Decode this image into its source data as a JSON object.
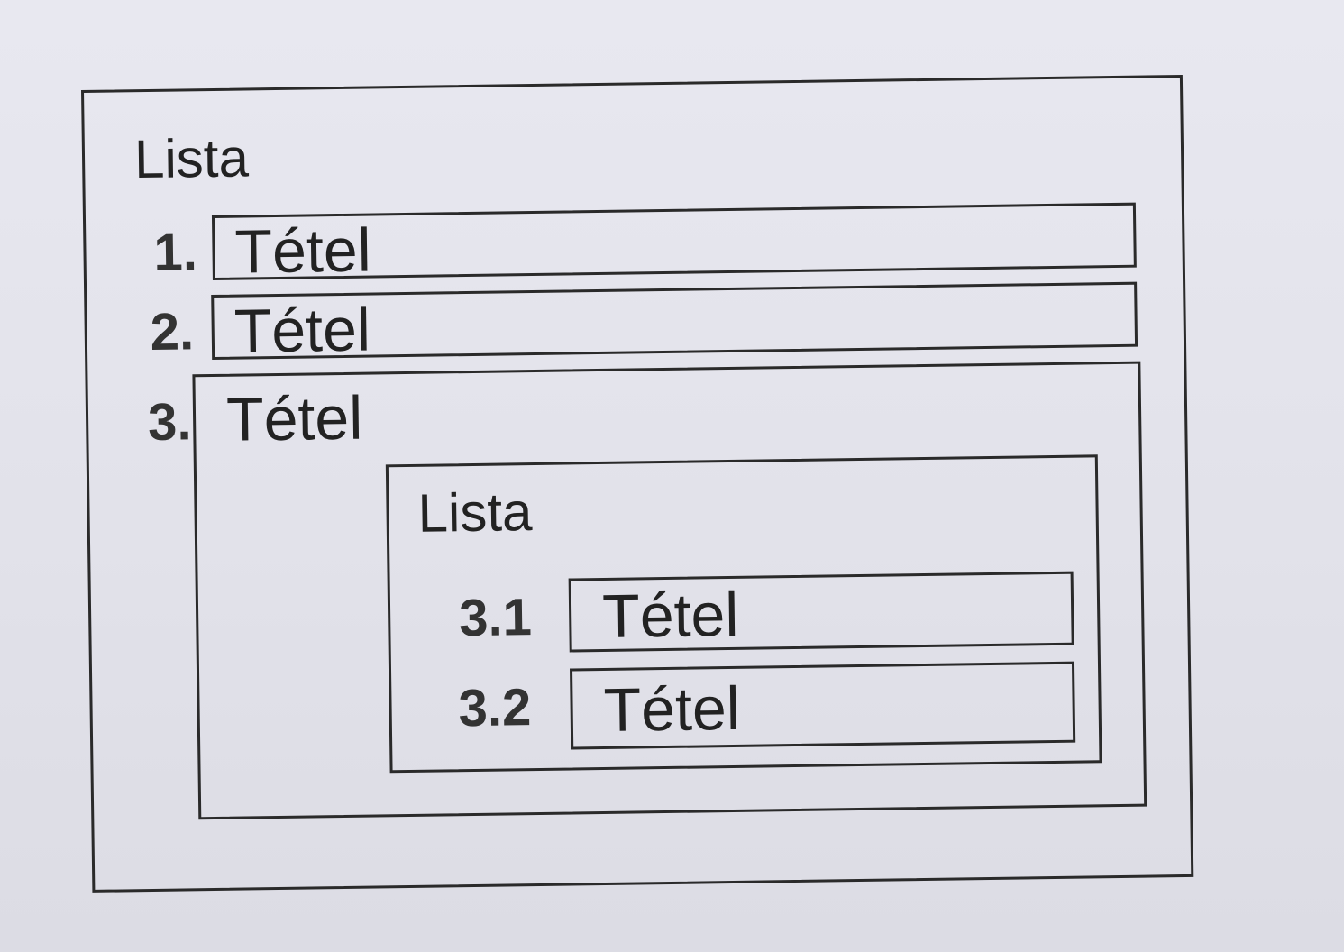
{
  "outer_list": {
    "title": "Lista",
    "items": [
      {
        "number": "1.",
        "text": "Tétel"
      },
      {
        "number": "2.",
        "text": "Tétel"
      },
      {
        "number": "3.",
        "text": "Tétel"
      }
    ]
  },
  "inner_list": {
    "title": "Lista",
    "items": [
      {
        "number": "3.1",
        "text": "Tétel"
      },
      {
        "number": "3.2",
        "text": "Tétel"
      }
    ]
  },
  "colors": {
    "paper": "#e4e4ec",
    "ink": "#2a2a2a"
  }
}
